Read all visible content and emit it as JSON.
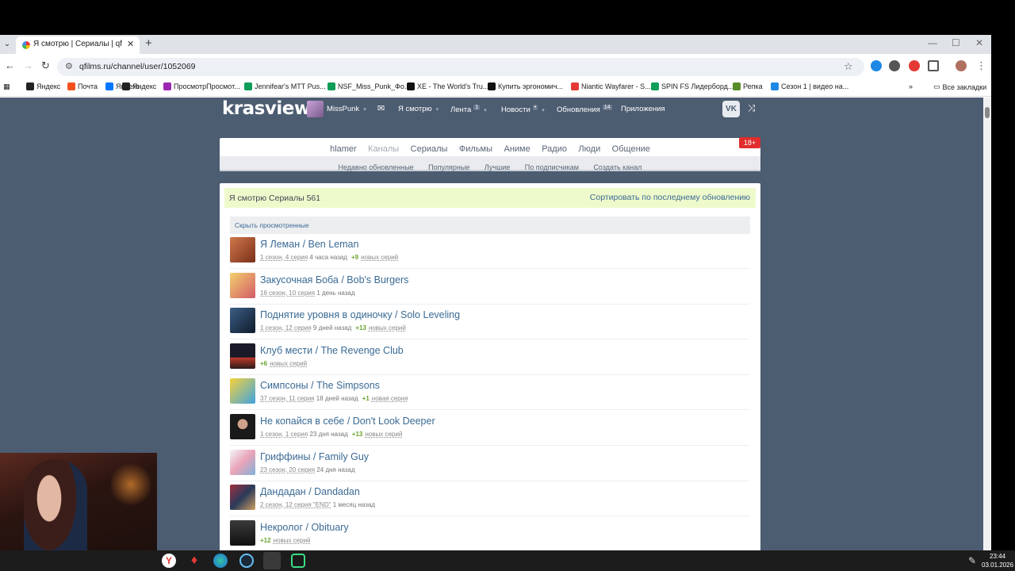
{
  "browser": {
    "tab_title": "Я смотрю | Сериалы | qfilms.ru",
    "tab_close": "✕",
    "new_tab": "+",
    "url": "qfilms.ru/channel/user/1052069",
    "bookmarks": [
      {
        "label": "Яндекс",
        "color": "#222"
      },
      {
        "label": "Почта",
        "color": "#f4511e"
      },
      {
        "label": "Яндекс",
        "color": "#0077ff"
      },
      {
        "label": "Яндекс",
        "color": "#222"
      },
      {
        "label": "ПросмотрПросмот...",
        "color": "#9c27b0"
      },
      {
        "label": "Jennifear's MTT Pus...",
        "color": "#0f9d58"
      },
      {
        "label": "NSF_Miss_Punk_Фо...",
        "color": "#0f9d58"
      },
      {
        "label": "XE - The World's Tru...",
        "color": "#111"
      },
      {
        "label": "Купить эргономич...",
        "color": "#111"
      },
      {
        "label": "Niantic Wayfarer - S...",
        "color": "#e53935"
      },
      {
        "label": "SPIN FS Лидерборд...",
        "color": "#0f9d58"
      },
      {
        "label": "Репка",
        "color": "#5b8c2a"
      },
      {
        "label": "Сезон 1 | видео на...",
        "color": "#1e88e5"
      }
    ],
    "all_bookmarks": "Все закладки"
  },
  "site": {
    "logo": "krasview",
    "username": "MissPunk",
    "nav": [
      {
        "label": "Я смотрю",
        "count": ""
      },
      {
        "label": "Лента",
        "count": "1"
      },
      {
        "label": "Новости",
        "count": "•"
      },
      {
        "label": "Обновления",
        "count": "14"
      },
      {
        "label": "Приложения",
        "count": ""
      }
    ],
    "vk": "VK",
    "categories": [
      "hlamer",
      "Каналы",
      "Сериалы",
      "Фильмы",
      "Аниме",
      "Радио",
      "Люди",
      "Общение"
    ],
    "active_category": "Каналы",
    "subcategories": [
      "Недавно обновленные",
      "Популярные",
      "Лучшие",
      "По подписчикам",
      "Создать канал"
    ],
    "age_badge": "18+",
    "banner_title": "Я смотрю Сериалы 561",
    "banner_sort": "Сортировать по последнему обновлению",
    "hide_watched": "Скрыть просмотренные",
    "items": [
      {
        "title": "Я Леман / Ben Leman",
        "episode": "1 сезон, 4 серия",
        "time": "4 часа назад",
        "plus": "+9",
        "new_label": "новых серий",
        "color": "#b4552f"
      },
      {
        "title": "Закусочная Боба / Bob's Burgers",
        "episode": "16 сезон, 10 серия",
        "time": "1 день назад",
        "plus": "",
        "new_label": "",
        "color": "#e7b93a"
      },
      {
        "title": "Поднятие уровня в одиночку / Solo Leveling",
        "episode": "1 сезон, 12 серия",
        "time": "9 дней назад",
        "plus": "+13",
        "new_label": "новых серий",
        "color": "#2c3e5a"
      },
      {
        "title": "Клуб мести / The Revenge Club",
        "episode": "",
        "time": "",
        "plus": "+6",
        "new_label": "новых серий",
        "color": "#2a2a35"
      },
      {
        "title": "Симпсоны / The Simpsons",
        "episode": "37 сезон, 11 серия",
        "time": "18 дней назад",
        "plus": "+1",
        "new_label": "новая серия",
        "color": "#f3c623"
      },
      {
        "title": "Не копайся в себе / Don't Look Deeper",
        "episode": "1 сезон, 1 серия",
        "time": "23 дня назад",
        "plus": "+13",
        "new_label": "новых серий",
        "color": "#3a3a3a"
      },
      {
        "title": "Гриффины / Family Guy",
        "episode": "23 сезон, 20 серия",
        "time": "24 дня назад",
        "plus": "",
        "new_label": "",
        "color": "#d9e7f2"
      },
      {
        "title": "Дандадан / Dandadan",
        "episode": "2 сезон, 12 серия \"END\"",
        "time": "1 месяц назад",
        "plus": "",
        "new_label": "",
        "color": "#8a2d3a"
      },
      {
        "title": "Некролог / Obituary",
        "episode": "",
        "time": "",
        "plus": "+12",
        "new_label": "новых серий",
        "color": "#2b2b2b"
      }
    ]
  },
  "taskbar": {
    "time": "23:44",
    "date": "03.01.2026"
  }
}
